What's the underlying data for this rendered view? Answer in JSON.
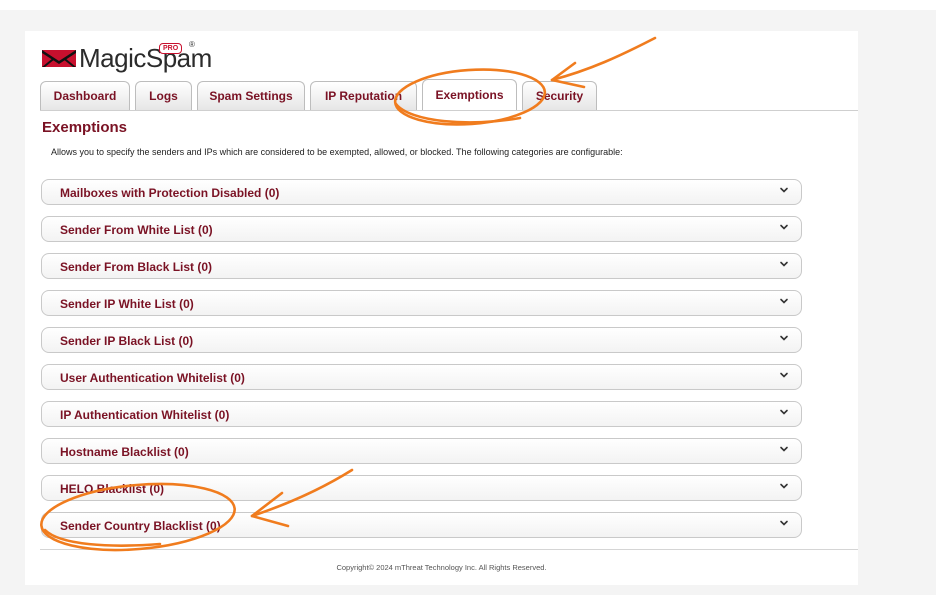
{
  "brand": {
    "name": "MagicSpam",
    "badge": "PRO",
    "registered": "®"
  },
  "tabs": [
    {
      "label": "Dashboard",
      "active": false
    },
    {
      "label": "Logs",
      "active": false
    },
    {
      "label": "Spam Settings",
      "active": false
    },
    {
      "label": "IP Reputation",
      "active": false
    },
    {
      "label": "Exemptions",
      "active": true
    },
    {
      "label": "Security",
      "active": false
    }
  ],
  "page": {
    "title": "Exemptions",
    "description": "Allows you to specify the senders and IPs which are considered to be exempted, allowed, or blocked. The following categories are configurable:"
  },
  "sections": [
    {
      "label": "Mailboxes with Protection Disabled (0)"
    },
    {
      "label": "Sender From White List (0)"
    },
    {
      "label": "Sender From Black List (0)"
    },
    {
      "label": "Sender IP White List (0)"
    },
    {
      "label": "Sender IP Black List (0)"
    },
    {
      "label": "User Authentication Whitelist (0)"
    },
    {
      "label": "IP Authentication Whitelist (0)"
    },
    {
      "label": "Hostname Blacklist (0)"
    },
    {
      "label": "HELO Blacklist (0)"
    },
    {
      "label": "Sender Country Blacklist (0)"
    }
  ],
  "footer": {
    "copyright": "Copyright© 2024 mThreat Technology Inc. All Rights Reserved."
  },
  "colors": {
    "accent": "#7a1224",
    "annotation": "#f07c1e"
  },
  "icons": {
    "logo": "magicspam-logo-icon",
    "chevron": "chevron-down-icon"
  }
}
